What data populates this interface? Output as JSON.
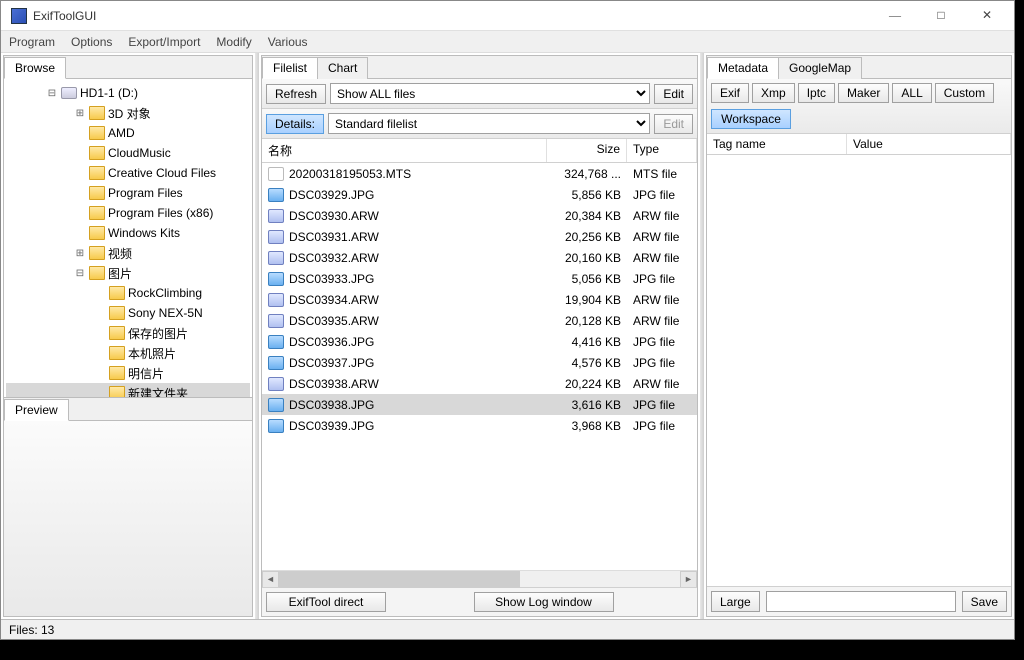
{
  "window": {
    "title": "ExifToolGUI"
  },
  "menu": {
    "program": "Program",
    "options": "Options",
    "export_import": "Export/Import",
    "modify": "Modify",
    "various": "Various"
  },
  "browse": {
    "tab": "Browse",
    "tree": [
      {
        "indent": 40,
        "expander": "⊟",
        "icon": "drive",
        "label": "HD1-1 (D:)"
      },
      {
        "indent": 68,
        "expander": "⊞",
        "icon": "folder",
        "label": "3D 对象"
      },
      {
        "indent": 68,
        "expander": "",
        "icon": "folder",
        "label": "AMD"
      },
      {
        "indent": 68,
        "expander": "",
        "icon": "folder",
        "label": "CloudMusic"
      },
      {
        "indent": 68,
        "expander": "",
        "icon": "folder",
        "label": "Creative Cloud Files"
      },
      {
        "indent": 68,
        "expander": "",
        "icon": "folder",
        "label": "Program Files"
      },
      {
        "indent": 68,
        "expander": "",
        "icon": "folder",
        "label": "Program Files (x86)"
      },
      {
        "indent": 68,
        "expander": "",
        "icon": "folder",
        "label": "Windows Kits"
      },
      {
        "indent": 68,
        "expander": "⊞",
        "icon": "folder",
        "label": "视频"
      },
      {
        "indent": 68,
        "expander": "⊟",
        "icon": "folder",
        "label": "图片"
      },
      {
        "indent": 88,
        "expander": "",
        "icon": "folder",
        "label": "RockClimbing"
      },
      {
        "indent": 88,
        "expander": "",
        "icon": "folder",
        "label": "Sony NEX-5N"
      },
      {
        "indent": 88,
        "expander": "",
        "icon": "folder",
        "label": "保存的图片"
      },
      {
        "indent": 88,
        "expander": "",
        "icon": "folder",
        "label": "本机照片"
      },
      {
        "indent": 88,
        "expander": "",
        "icon": "folder",
        "label": "明信片"
      },
      {
        "indent": 88,
        "expander": "",
        "icon": "folder",
        "label": "新建文件夹",
        "selected": true
      }
    ],
    "preview_tab": "Preview"
  },
  "filelist": {
    "tabs": {
      "filelist": "Filelist",
      "chart": "Chart"
    },
    "buttons": {
      "refresh": "Refresh",
      "details": "Details:",
      "edit": "Edit"
    },
    "filter_select": "Show ALL files",
    "columns_select": "Standard filelist",
    "headers": {
      "name": "名称",
      "size": "Size",
      "type": "Type"
    },
    "files": [
      {
        "icon": "mts",
        "name": "20200318195053.MTS",
        "size": "324,768 ...",
        "type": "MTS file"
      },
      {
        "icon": "jpg",
        "name": "DSC03929.JPG",
        "size": "5,856 KB",
        "type": "JPG file"
      },
      {
        "icon": "arw",
        "name": "DSC03930.ARW",
        "size": "20,384 KB",
        "type": "ARW file"
      },
      {
        "icon": "arw",
        "name": "DSC03931.ARW",
        "size": "20,256 KB",
        "type": "ARW file"
      },
      {
        "icon": "arw",
        "name": "DSC03932.ARW",
        "size": "20,160 KB",
        "type": "ARW file"
      },
      {
        "icon": "jpg",
        "name": "DSC03933.JPG",
        "size": "5,056 KB",
        "type": "JPG file"
      },
      {
        "icon": "arw",
        "name": "DSC03934.ARW",
        "size": "19,904 KB",
        "type": "ARW file"
      },
      {
        "icon": "arw",
        "name": "DSC03935.ARW",
        "size": "20,128 KB",
        "type": "ARW file"
      },
      {
        "icon": "jpg",
        "name": "DSC03936.JPG",
        "size": "4,416 KB",
        "type": "JPG file"
      },
      {
        "icon": "jpg",
        "name": "DSC03937.JPG",
        "size": "4,576 KB",
        "type": "JPG file"
      },
      {
        "icon": "arw",
        "name": "DSC03938.ARW",
        "size": "20,224 KB",
        "type": "ARW file"
      },
      {
        "icon": "jpg",
        "name": "DSC03938.JPG",
        "size": "3,616 KB",
        "type": "JPG file",
        "selected": true
      },
      {
        "icon": "jpg",
        "name": "DSC03939.JPG",
        "size": "3,968 KB",
        "type": "JPG file"
      }
    ],
    "footer": {
      "exiftool_direct": "ExifTool direct",
      "show_log": "Show Log window"
    }
  },
  "metadata": {
    "tabs": {
      "metadata": "Metadata",
      "googlemap": "GoogleMap"
    },
    "buttons": {
      "exif": "Exif",
      "xmp": "Xmp",
      "iptc": "Iptc",
      "maker": "Maker",
      "all": "ALL",
      "custom": "Custom",
      "workspace": "Workspace"
    },
    "headers": {
      "tagname": "Tag name",
      "value": "Value"
    },
    "footer": {
      "large": "Large",
      "save": "Save"
    }
  },
  "statusbar": {
    "files": "Files: 13"
  }
}
